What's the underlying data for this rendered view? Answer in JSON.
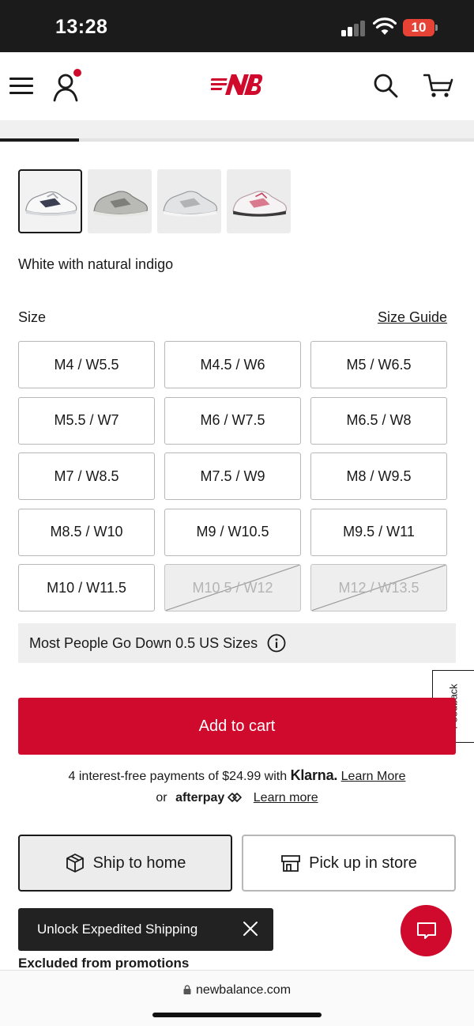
{
  "status_bar": {
    "time": "13:28",
    "battery": "10"
  },
  "nav": {
    "brand": "New Balance"
  },
  "gallery": {
    "progress_fraction": 0.167
  },
  "swatches": [
    {
      "name": "swatch-white-natural-indigo",
      "selected": true
    },
    {
      "name": "swatch-grey",
      "selected": false
    },
    {
      "name": "swatch-silver",
      "selected": false
    },
    {
      "name": "swatch-white-pink",
      "selected": false
    }
  ],
  "product": {
    "color_name": "White with natural indigo"
  },
  "size_section": {
    "label": "Size",
    "guide_label": "Size Guide",
    "sizes": [
      {
        "label": "M4 / W5.5",
        "available": true
      },
      {
        "label": "M4.5 / W6",
        "available": true
      },
      {
        "label": "M5 / W6.5",
        "available": true
      },
      {
        "label": "M5.5 / W7",
        "available": true
      },
      {
        "label": "M6 / W7.5",
        "available": true
      },
      {
        "label": "M6.5 / W8",
        "available": true
      },
      {
        "label": "M7 / W8.5",
        "available": true
      },
      {
        "label": "M7.5 / W9",
        "available": true
      },
      {
        "label": "M8 / W9.5",
        "available": true
      },
      {
        "label": "M8.5 / W10",
        "available": true
      },
      {
        "label": "M9 / W10.5",
        "available": true
      },
      {
        "label": "M9.5 / W11",
        "available": true
      },
      {
        "label": "M10 / W11.5",
        "available": true
      },
      {
        "label": "M10.5 / W12",
        "available": false
      },
      {
        "label": "M12 / W13.5",
        "available": false
      }
    ],
    "fit_note": "Most People Go Down 0.5 US Sizes"
  },
  "feedback": {
    "label": "Feedback"
  },
  "cart": {
    "add_label": "Add to cart"
  },
  "payments": {
    "klarna_prefix": "4 interest-free payments of $24.99 with",
    "klarna_brand": "Klarna.",
    "klarna_link": "Learn More",
    "afterpay_prefix": "or",
    "afterpay_brand": "afterpay",
    "afterpay_link": "Learn more"
  },
  "fulfillment": {
    "ship_label": "Ship to home",
    "pickup_label": "Pick up in store"
  },
  "toast": {
    "text": "Unlock Expedited Shipping"
  },
  "promo": {
    "excluded_text": "Excluded from promotions"
  },
  "browser": {
    "url": "newbalance.com"
  },
  "colors": {
    "brand_red": "#cf0a2c",
    "text": "#1a1a1a"
  }
}
